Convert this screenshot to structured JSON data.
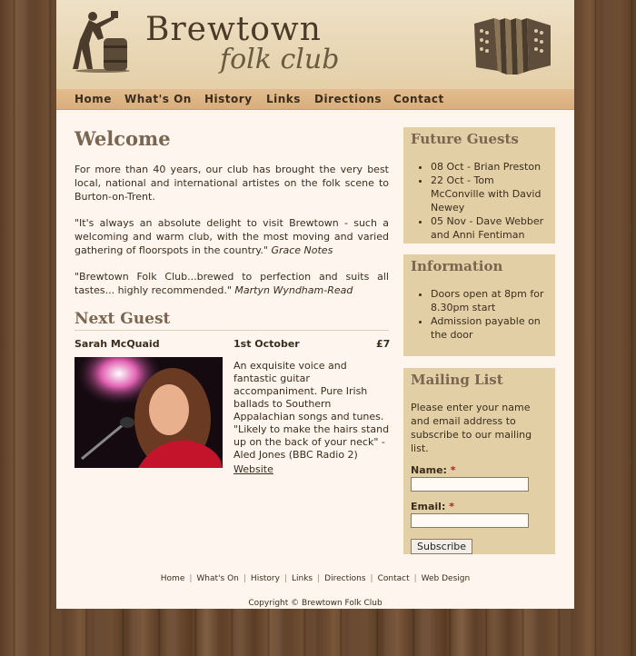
{
  "site": {
    "title": "Brewtown",
    "subtitle": "folk club"
  },
  "nav": {
    "items": [
      "Home",
      "What's On",
      "History",
      "Links",
      "Directions",
      "Contact"
    ]
  },
  "main": {
    "welcome_heading": "Welcome",
    "intro": "For more than 40 years, our club has brought the very best local, national and international artistes on the folk scene to Burton-on-Trent.",
    "quote1_text": "\"It's always an absolute delight to visit Brewtown - such a welcoming and warm club, with the most moving and varied gathering of floorspots in the country.\"",
    "quote1_source": "Grace Notes",
    "quote2_text": "\"Brewtown Folk Club...brewed to perfection and suits all tastes... highly recommended.\"",
    "quote2_source": "Martyn Wyndham-Read",
    "next_guest_heading": "Next Guest",
    "guest": {
      "name": "Sarah McQuaid",
      "date": "1st October",
      "price": "£7",
      "description": "An exquisite voice and fantastic guitar accompaniment. Pure Irish ballads to Southern Appalachian songs and tunes. \"Likely to make the hairs stand up on the back of your neck\" - Aled Jones (BBC Radio 2)",
      "link_label": "Website"
    }
  },
  "sidebar": {
    "future_guests": {
      "heading": "Future Guests",
      "items": [
        "08 Oct - Brian Preston",
        "22 Oct - Tom McConville with David Newey",
        "05 Nov - Dave Webber and Anni Fentiman"
      ]
    },
    "information": {
      "heading": "Information",
      "items": [
        "Doors open at 8pm for 8.30pm start",
        "Admission payable on the door"
      ]
    },
    "mailing_list": {
      "heading": "Mailing List",
      "text": "Please enter your name and email address to subscribe to our mailing list.",
      "name_label": "Name:",
      "email_label": "Email:",
      "required_mark": "*",
      "subscribe_label": "Subscribe"
    }
  },
  "footer": {
    "links": [
      "Home",
      "What's On",
      "History",
      "Links",
      "Directions",
      "Contact",
      "Web Design"
    ],
    "copyright": "Copyright © Brewtown Folk Club"
  },
  "colors": {
    "page_bg": "#fef5ee",
    "header_bg": "#e4cfa8",
    "nav_bg": "#d8ae7c",
    "box_bg": "#e3cfa6",
    "heading": "#7a6650",
    "text": "#3b2d1c"
  }
}
